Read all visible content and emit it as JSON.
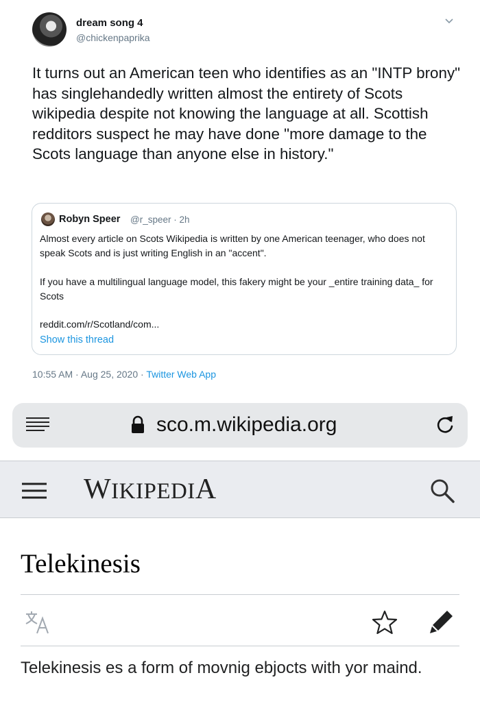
{
  "tweet": {
    "author_name": "dream song 4",
    "author_handle": "@chickenpaprika",
    "text": "It turns out an American teen who identifies as an \"INTP brony\" has singlehandedly written almost the entirety of Scots wikipedia despite not knowing the language at all. Scottish redditors suspect he may have done \"more damage to the Scots language than anyone else in history.\"",
    "timestamp": "10:55 AM · Aug 25, 2020 · ",
    "app": "Twitter Web App",
    "caret_icon": "chevron-down-icon"
  },
  "quote": {
    "author_name": "Robyn Speer",
    "meta": "@r_speer · 2h",
    "text_1": "Almost every article on Scots Wikipedia is written by one American teenager, who does not speak Scots and is just writing English in an \"accent\".",
    "text_2": "If you have a multilingual language model, this fakery might be your _entire training data_ for Scots",
    "link": "reddit.com/r/Scotland/com...",
    "show_thread": "Show this thread"
  },
  "browser": {
    "url": "sco.m.wikipedia.org",
    "icons": [
      "reader-icon",
      "lock-icon",
      "reload-icon"
    ]
  },
  "wiki": {
    "logo_w": "W",
    "logo_iki": "IKIPEDI",
    "logo_a": "A",
    "icons": [
      "hamburger-icon",
      "search-icon",
      "translate-icon",
      "star-icon",
      "edit-icon"
    ],
    "article_title": "Telekinesis",
    "article_text": "Telekinesis es a form of movnig ebjocts with yor maind."
  },
  "colors": {
    "link_blue": "#1b95e0",
    "secondary_gray": "#657786",
    "wiki_header_bg": "#eaecf0"
  }
}
